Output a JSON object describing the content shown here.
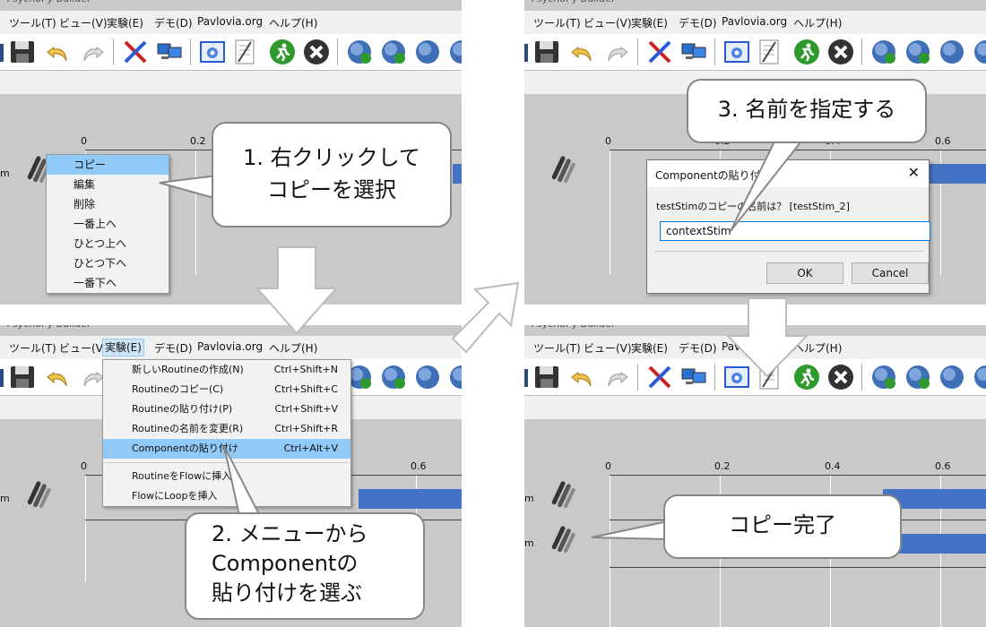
{
  "window_title": "- PsychoPy Builder",
  "menubar": {
    "tools": "ツール(T)",
    "view": "ビュー(V)",
    "experiment": "実験(E)",
    "demos": "デモ(D)",
    "pavlovia": "Pavlovia.org",
    "help": "ヘルプ(H)"
  },
  "timeline": {
    "ticks_left": [
      "0",
      "0.2"
    ],
    "ticks_bottom_left": [
      "0",
      "0.6"
    ],
    "ticks_right": [
      "0",
      "0.2",
      "0.4",
      "0.6"
    ],
    "row_label": "m"
  },
  "context_menu": [
    "コピー",
    "編集",
    "削除",
    "一番上へ",
    "ひとつ上へ",
    "ひとつ下へ",
    "一番下へ"
  ],
  "experiment_menu": [
    {
      "label": "新しいRoutineの作成(N)",
      "shortcut": "Ctrl+Shift+N"
    },
    {
      "label": "Routineのコピー(C)",
      "shortcut": "Ctrl+Shift+C"
    },
    {
      "label": "Routineの貼り付け(P)",
      "shortcut": "Ctrl+Shift+V"
    },
    {
      "label": "Routineの名前を変更(R)",
      "shortcut": "Ctrl+Shift+R"
    },
    {
      "label": "Componentの貼り付け",
      "shortcut": "Ctrl+Alt+V"
    },
    {
      "label": "RoutineをFlowに挿入",
      "shortcut": ""
    },
    {
      "label": "FlowにLoopを挿入",
      "shortcut": ""
    }
  ],
  "dialog": {
    "title": "Componentの貼り付け",
    "prompt": "testStimのコピーの名前は？ [testStim_2]",
    "input_value": "contextStim",
    "ok": "OK",
    "cancel": "Cancel"
  },
  "callouts": {
    "step1_line1": "1. 右クリックして",
    "step1_line2": "コピーを選択",
    "step2_line1": "2. メニューから",
    "step2_line2": "Componentの",
    "step2_line3": "貼り付けを選ぶ",
    "step3": "3. 名前を指定する",
    "done": "コピー完了"
  },
  "colors": {
    "bar": "#4472c4",
    "menu_highlight": "#91c9f7",
    "arrow": "#ffffff"
  }
}
